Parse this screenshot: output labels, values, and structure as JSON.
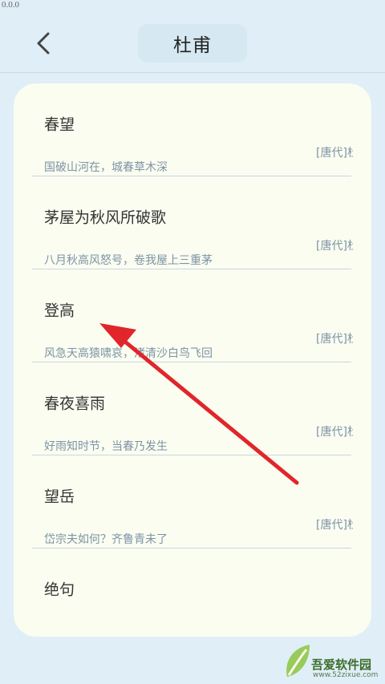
{
  "status_bar": {
    "text": "0.0.0"
  },
  "header": {
    "title": "杜甫"
  },
  "poems": [
    {
      "title": "春望",
      "first_line": "国破山河在，城春草木深",
      "author": "[唐代]杜甫"
    },
    {
      "title": "茅屋为秋风所破歌",
      "first_line": "八月秋高风怒号，卷我屋上三重茅",
      "author": "[唐代]杜甫"
    },
    {
      "title": "登高",
      "first_line": "风急天高猿啸哀，渚清沙白鸟飞回",
      "author": "[唐代]杜甫"
    },
    {
      "title": "春夜喜雨",
      "first_line": "好雨知时节，当春乃发生",
      "author": "[唐代]杜甫"
    },
    {
      "title": "望岳",
      "first_line": "岱宗夫如何？齐鲁青未了",
      "author": "[唐代]杜甫"
    },
    {
      "title": "绝句",
      "first_line": "",
      "author": ""
    }
  ],
  "watermark": {
    "brand": "吾爱软件园",
    "url": "www.52zixue.com"
  },
  "colors": {
    "annotation_arrow": "#e0262b"
  }
}
